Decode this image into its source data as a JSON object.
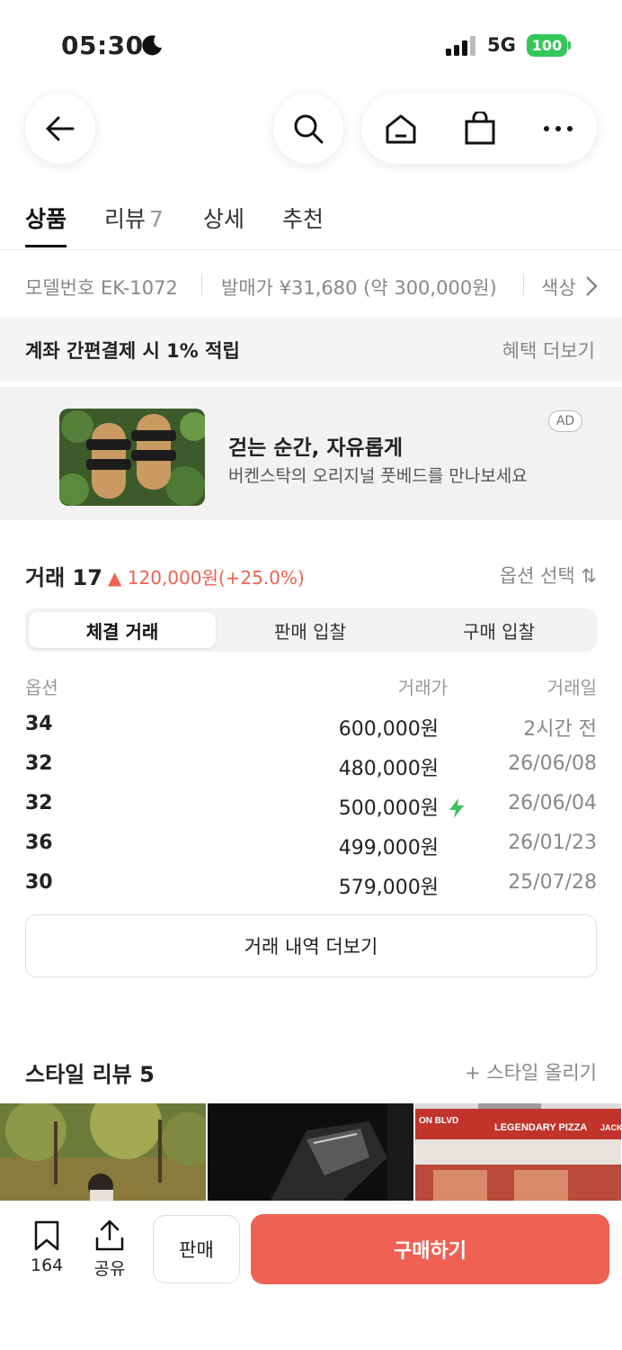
{
  "status_bar": {
    "time": "05:30",
    "network": "5G",
    "battery": "100"
  },
  "nav": {
    "back_icon": "arrow-left-icon",
    "search_icon": "search-icon",
    "home_icon": "home-icon",
    "bag_icon": "shopping-bag-icon",
    "more_icon": "more-dots-icon"
  },
  "tabs": [
    {
      "label": "상품"
    },
    {
      "label": "리뷰",
      "count": "7"
    },
    {
      "label": "상세"
    },
    {
      "label": "추천"
    }
  ],
  "info": {
    "model": "모델번호 EK-1072",
    "release_price": "발매가 ¥31,680 (약 300,000원)",
    "color": "색상"
  },
  "benefit": {
    "text": "계좌 간편결제 시 1% 적립",
    "more": "혜택 더보기"
  },
  "ad": {
    "badge": "AD",
    "title": "걷는 순간, 자유롭게",
    "subtitle": "버켄스탁의 오리지널 풋베드를 만나보세요"
  },
  "trade": {
    "title": "거래 17",
    "change": "▲ 120,000원(+25.0%)",
    "option_select": "옵션 선택 ⇅",
    "segments": [
      "체결 거래",
      "판매 입찰",
      "구매 입찰"
    ],
    "columns": {
      "option": "옵션",
      "price": "거래가",
      "date": "거래일"
    },
    "rows": [
      {
        "option": "34",
        "price": "600,000원",
        "date": "2시간 전"
      },
      {
        "option": "32",
        "price": "480,000원",
        "date": "26/06/08"
      },
      {
        "option": "32",
        "price": "500,000원",
        "date": "26/06/04",
        "quick": true
      },
      {
        "option": "36",
        "price": "499,000원",
        "date": "26/01/23"
      },
      {
        "option": "30",
        "price": "579,000원",
        "date": "25/07/28"
      }
    ],
    "more_button": "거래 내역 더보기"
  },
  "style_review": {
    "title": "스타일 리뷰 5",
    "upload": "+ 스타일 올리기",
    "photo3_sign1": "ON BLVD",
    "photo3_sign2": "LEGENDARY PIZZA",
    "photo3_sign3": "JACK"
  },
  "bottom": {
    "bookmark_count": "164",
    "share_label": "공유",
    "sell_label": "판매",
    "buy_label": "구매하기"
  },
  "colors": {
    "accent": "#ef6253",
    "lightning": "#3cc15d"
  }
}
